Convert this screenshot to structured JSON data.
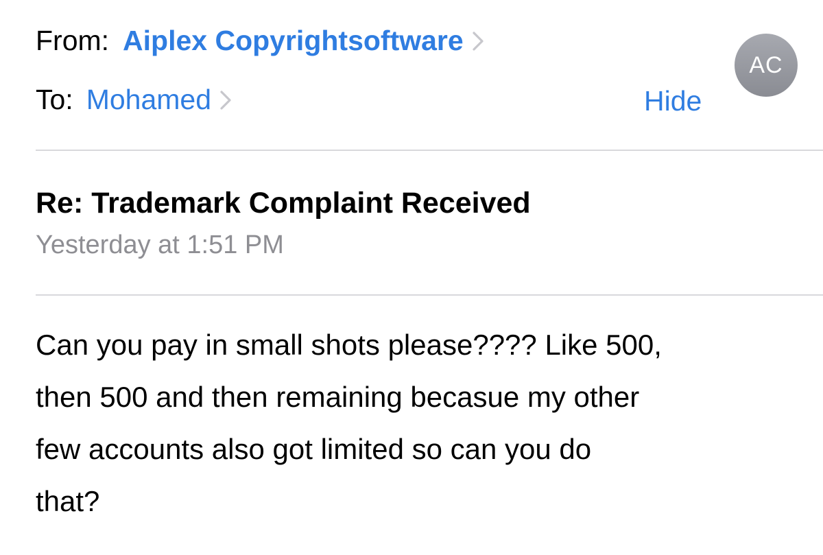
{
  "header": {
    "from_label": "From:",
    "from_name": "Aiplex Copyrightsoftware",
    "to_label": "To:",
    "to_name": "Mohamed",
    "hide_label": "Hide",
    "avatar_initials": "AC",
    "chevron_icon": "chevron-right-icon"
  },
  "message": {
    "subject": "Re: Trademark Complaint Received",
    "date": "Yesterday at 1:51 PM",
    "body_lines": [
      "Can you pay in small shots please???? Like 500,",
      "then 500 and then remaining becasue my other",
      "few accounts also got limited so can you do",
      "that?"
    ]
  },
  "colors": {
    "link": "#2f7de1",
    "secondary_text": "#8e8e93",
    "divider": "#d8d8dc",
    "avatar": "#9a9ca3"
  }
}
